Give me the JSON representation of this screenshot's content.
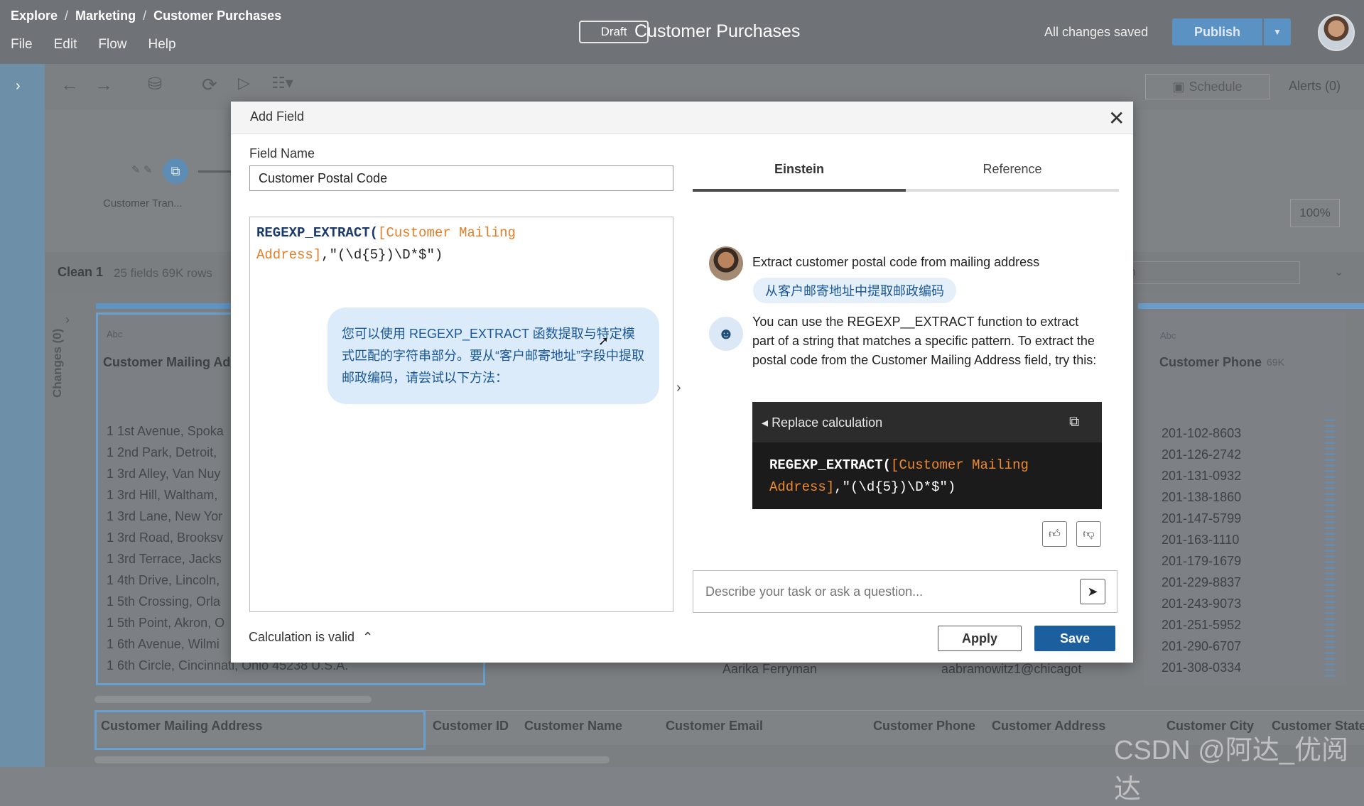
{
  "header": {
    "breadcrumb": [
      "Explore",
      "Marketing",
      "Customer Purchases"
    ],
    "menu": [
      "File",
      "Edit",
      "Flow",
      "Help"
    ],
    "draft_badge": "Draft",
    "title": "Customer Purchases",
    "save_status": "All changes saved",
    "publish_label": "Publish"
  },
  "toolbar": {
    "schedule_label": "Schedule",
    "alerts_label": "Alerts (0)"
  },
  "flow": {
    "node_label": "Customer Tran...",
    "zoom": "100%"
  },
  "clean": {
    "title": "Clean 1",
    "meta": "25 fields  69K rows",
    "search_partial": "h",
    "changes_label": "Changes (0)"
  },
  "profile_left": {
    "type": "Abc",
    "title": "Customer Mailing Ad",
    "rows": [
      "1 1st Avenue, Spoka",
      "1 2nd Park, Detroit,",
      "1 3rd Alley, Van Nuy",
      "1 3rd Hill, Waltham,",
      "1 3rd Lane, New Yor",
      "1 3rd Road, Brooksv",
      "1 3rd Terrace, Jacks",
      "1 4th Drive, Lincoln,",
      "1 5th Crossing, Orla",
      "1 5th Point, Akron, O",
      "1 6th Avenue, Wilmi",
      "1 6th Circle, Cincinnati, Ohio 45238 U.S.A."
    ]
  },
  "profile_right": {
    "type": "Abc",
    "title": "Customer Phone",
    "count": "69K",
    "rows": [
      "201-102-8603",
      "201-126-2742",
      "201-131-0932",
      "201-138-1860",
      "201-147-5799",
      "201-163-1110",
      "201-179-1679",
      "201-229-8837",
      "201-243-9073",
      "201-251-5952",
      "201-290-6707",
      "201-308-0334"
    ]
  },
  "background_rows": {
    "name": "Aarika Ferryman",
    "email": "aabramowitz1@chicagot"
  },
  "grid_headers": [
    "Customer Mailing Address",
    "Customer ID",
    "Customer Name",
    "Customer Email",
    "Customer Phone",
    "Customer Address",
    "Customer City",
    "Customer State"
  ],
  "dialog": {
    "title": "Add Field",
    "field_name_label": "Field Name",
    "field_name_value": "Customer Postal Code",
    "code": {
      "fn": "REGEXP_EXTRACT",
      "open": "(",
      "field_line1": "[Customer Mailing",
      "field_line2": "Address]",
      "rest": ",\"(\\d{5})\\D*$\")"
    },
    "tooltip_cn": "您可以使用 REGEXP_EXTRACT 函数提取与特定模式匹配的字符串部分。要从“客户邮寄地址”字段中提取邮政编码，请尝试以下方法：",
    "calc_status": "Calculation is valid",
    "tabs": [
      "Einstein",
      "Reference"
    ],
    "user_message": "Extract customer postal code from mailing address",
    "user_message_cn": "从客户邮寄地址中提取邮政编码",
    "bot_message": "You can use the REGEXP__EXTRACT function to extract part of a string that matches a specific pattern. To extract the postal code from the Customer Mailing Address field, try this:",
    "replace_label": "Replace calculation",
    "chat_placeholder": "Describe your task or ask a question...",
    "apply_label": "Apply",
    "save_label": "Save"
  },
  "watermark": "CSDN @阿达_优阅达",
  "colors": {
    "accent": "#1b5f9e",
    "field_orange": "#e37d26",
    "publish": "#5a92c4"
  }
}
